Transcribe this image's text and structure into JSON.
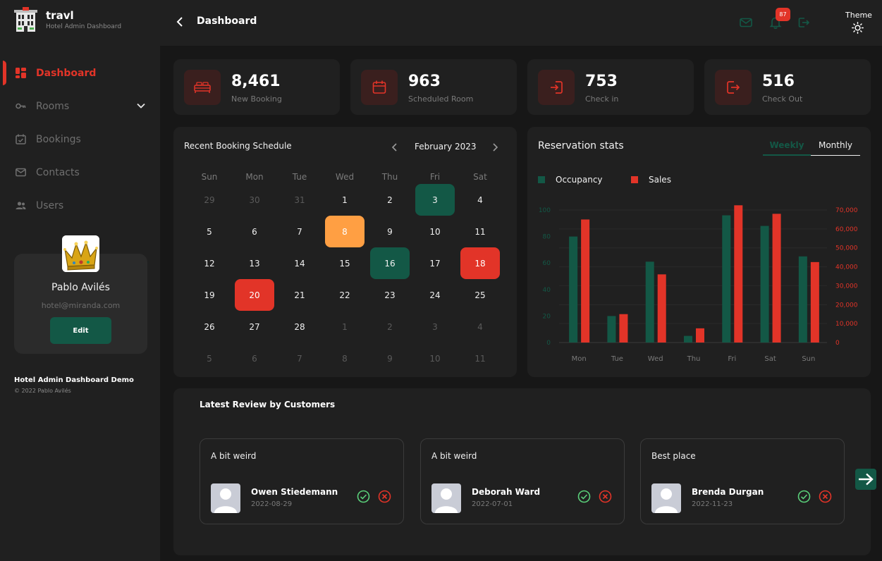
{
  "app": {
    "name": "travl",
    "subtitle": "Hotel Admin Dashboard"
  },
  "sidebar": {
    "items": [
      {
        "label": "Dashboard",
        "icon": "dashboard-icon",
        "active": true
      },
      {
        "label": "Rooms",
        "icon": "key-icon"
      },
      {
        "label": "Bookings",
        "icon": "calendar-check-icon"
      },
      {
        "label": "Contacts",
        "icon": "mail-icon"
      },
      {
        "label": "Users",
        "icon": "users-icon"
      }
    ],
    "user": {
      "name": "Pablo Avilés",
      "email": "hotel@miranda.com",
      "edit_label": "Edit"
    },
    "footer": {
      "title": "Hotel Admin Dashboard Demo",
      "copyright": "© 2022 Pablo Avilés"
    }
  },
  "header": {
    "title": "Dashboard",
    "notifications": "87",
    "theme_label": "Theme"
  },
  "stats": [
    {
      "value": "8,461",
      "label": "New Booking",
      "icon": "bed-icon"
    },
    {
      "value": "963",
      "label": "Scheduled Room",
      "icon": "calendar-icon"
    },
    {
      "value": "753",
      "label": "Check in",
      "icon": "login-icon"
    },
    {
      "value": "516",
      "label": "Check Out",
      "icon": "logout-icon"
    }
  ],
  "calendar": {
    "title": "Recent Booking Schedule",
    "month": "February 2023",
    "weekdays": [
      "Sun",
      "Mon",
      "Tue",
      "Wed",
      "Thu",
      "Fri",
      "Sat"
    ],
    "weeks": [
      [
        "29",
        "30",
        "31",
        "1",
        "2",
        "3",
        "4"
      ],
      [
        "5",
        "6",
        "7",
        "8",
        "9",
        "10",
        "11"
      ],
      [
        "12",
        "13",
        "14",
        "15",
        "16",
        "17",
        "18"
      ],
      [
        "19",
        "20",
        "21",
        "22",
        "23",
        "24",
        "25"
      ],
      [
        "26",
        "27",
        "28",
        "1",
        "2",
        "3",
        "4"
      ],
      [
        "5",
        "6",
        "7",
        "8",
        "9",
        "10",
        "11"
      ]
    ],
    "muted": [
      [
        0,
        0
      ],
      [
        0,
        1
      ],
      [
        0,
        2
      ],
      [
        4,
        3
      ],
      [
        4,
        4
      ],
      [
        4,
        5
      ],
      [
        4,
        6
      ],
      [
        5,
        0
      ],
      [
        5,
        1
      ],
      [
        5,
        2
      ],
      [
        5,
        3
      ],
      [
        5,
        4
      ],
      [
        5,
        5
      ],
      [
        5,
        6
      ]
    ],
    "highlights": [
      {
        "row": 0,
        "col": 5,
        "color": "green"
      },
      {
        "row": 1,
        "col": 3,
        "color": "orange"
      },
      {
        "row": 2,
        "col": 4,
        "color": "green"
      },
      {
        "row": 2,
        "col": 6,
        "color": "red"
      },
      {
        "row": 3,
        "col": 1,
        "color": "red"
      }
    ]
  },
  "reservation": {
    "title": "Reservation stats",
    "tabs": {
      "weekly": "Weekly",
      "monthly": "Monthly"
    },
    "colors": {
      "occupancy": "#135846",
      "sales": "#e23428"
    }
  },
  "chart_data": {
    "type": "bar",
    "categories": [
      "Mon",
      "Tue",
      "Wed",
      "Thu",
      "Fri",
      "Sat",
      "Sun"
    ],
    "series": [
      {
        "name": "Occupancy",
        "axis": "left",
        "values": [
          80,
          20,
          61,
          5,
          96,
          88,
          65
        ]
      },
      {
        "name": "Sales",
        "axis": "right",
        "values": [
          65000,
          15000,
          36000,
          7500,
          72500,
          68000,
          42500
        ]
      }
    ],
    "left_axis": {
      "ticks": [
        "0",
        "20",
        "40",
        "60",
        "80",
        "100"
      ],
      "ylim": [
        0,
        100
      ]
    },
    "right_axis": {
      "ticks": [
        "0",
        "10,000",
        "20,000",
        "30,000",
        "40,000",
        "50,000",
        "60,000",
        "70,000"
      ],
      "ylim": [
        0,
        70000
      ]
    },
    "legend": "top-left",
    "grid": true
  },
  "reviews": {
    "title": "Latest Review by Customers",
    "items": [
      {
        "text": "A bit weird",
        "name": "Owen Stiedemann",
        "date": "2022-08-29"
      },
      {
        "text": "A bit weird",
        "name": "Deborah Ward",
        "date": "2022-07-01"
      },
      {
        "text": "Best place",
        "name": "Brenda Durgan",
        "date": "2022-11-23"
      }
    ]
  }
}
